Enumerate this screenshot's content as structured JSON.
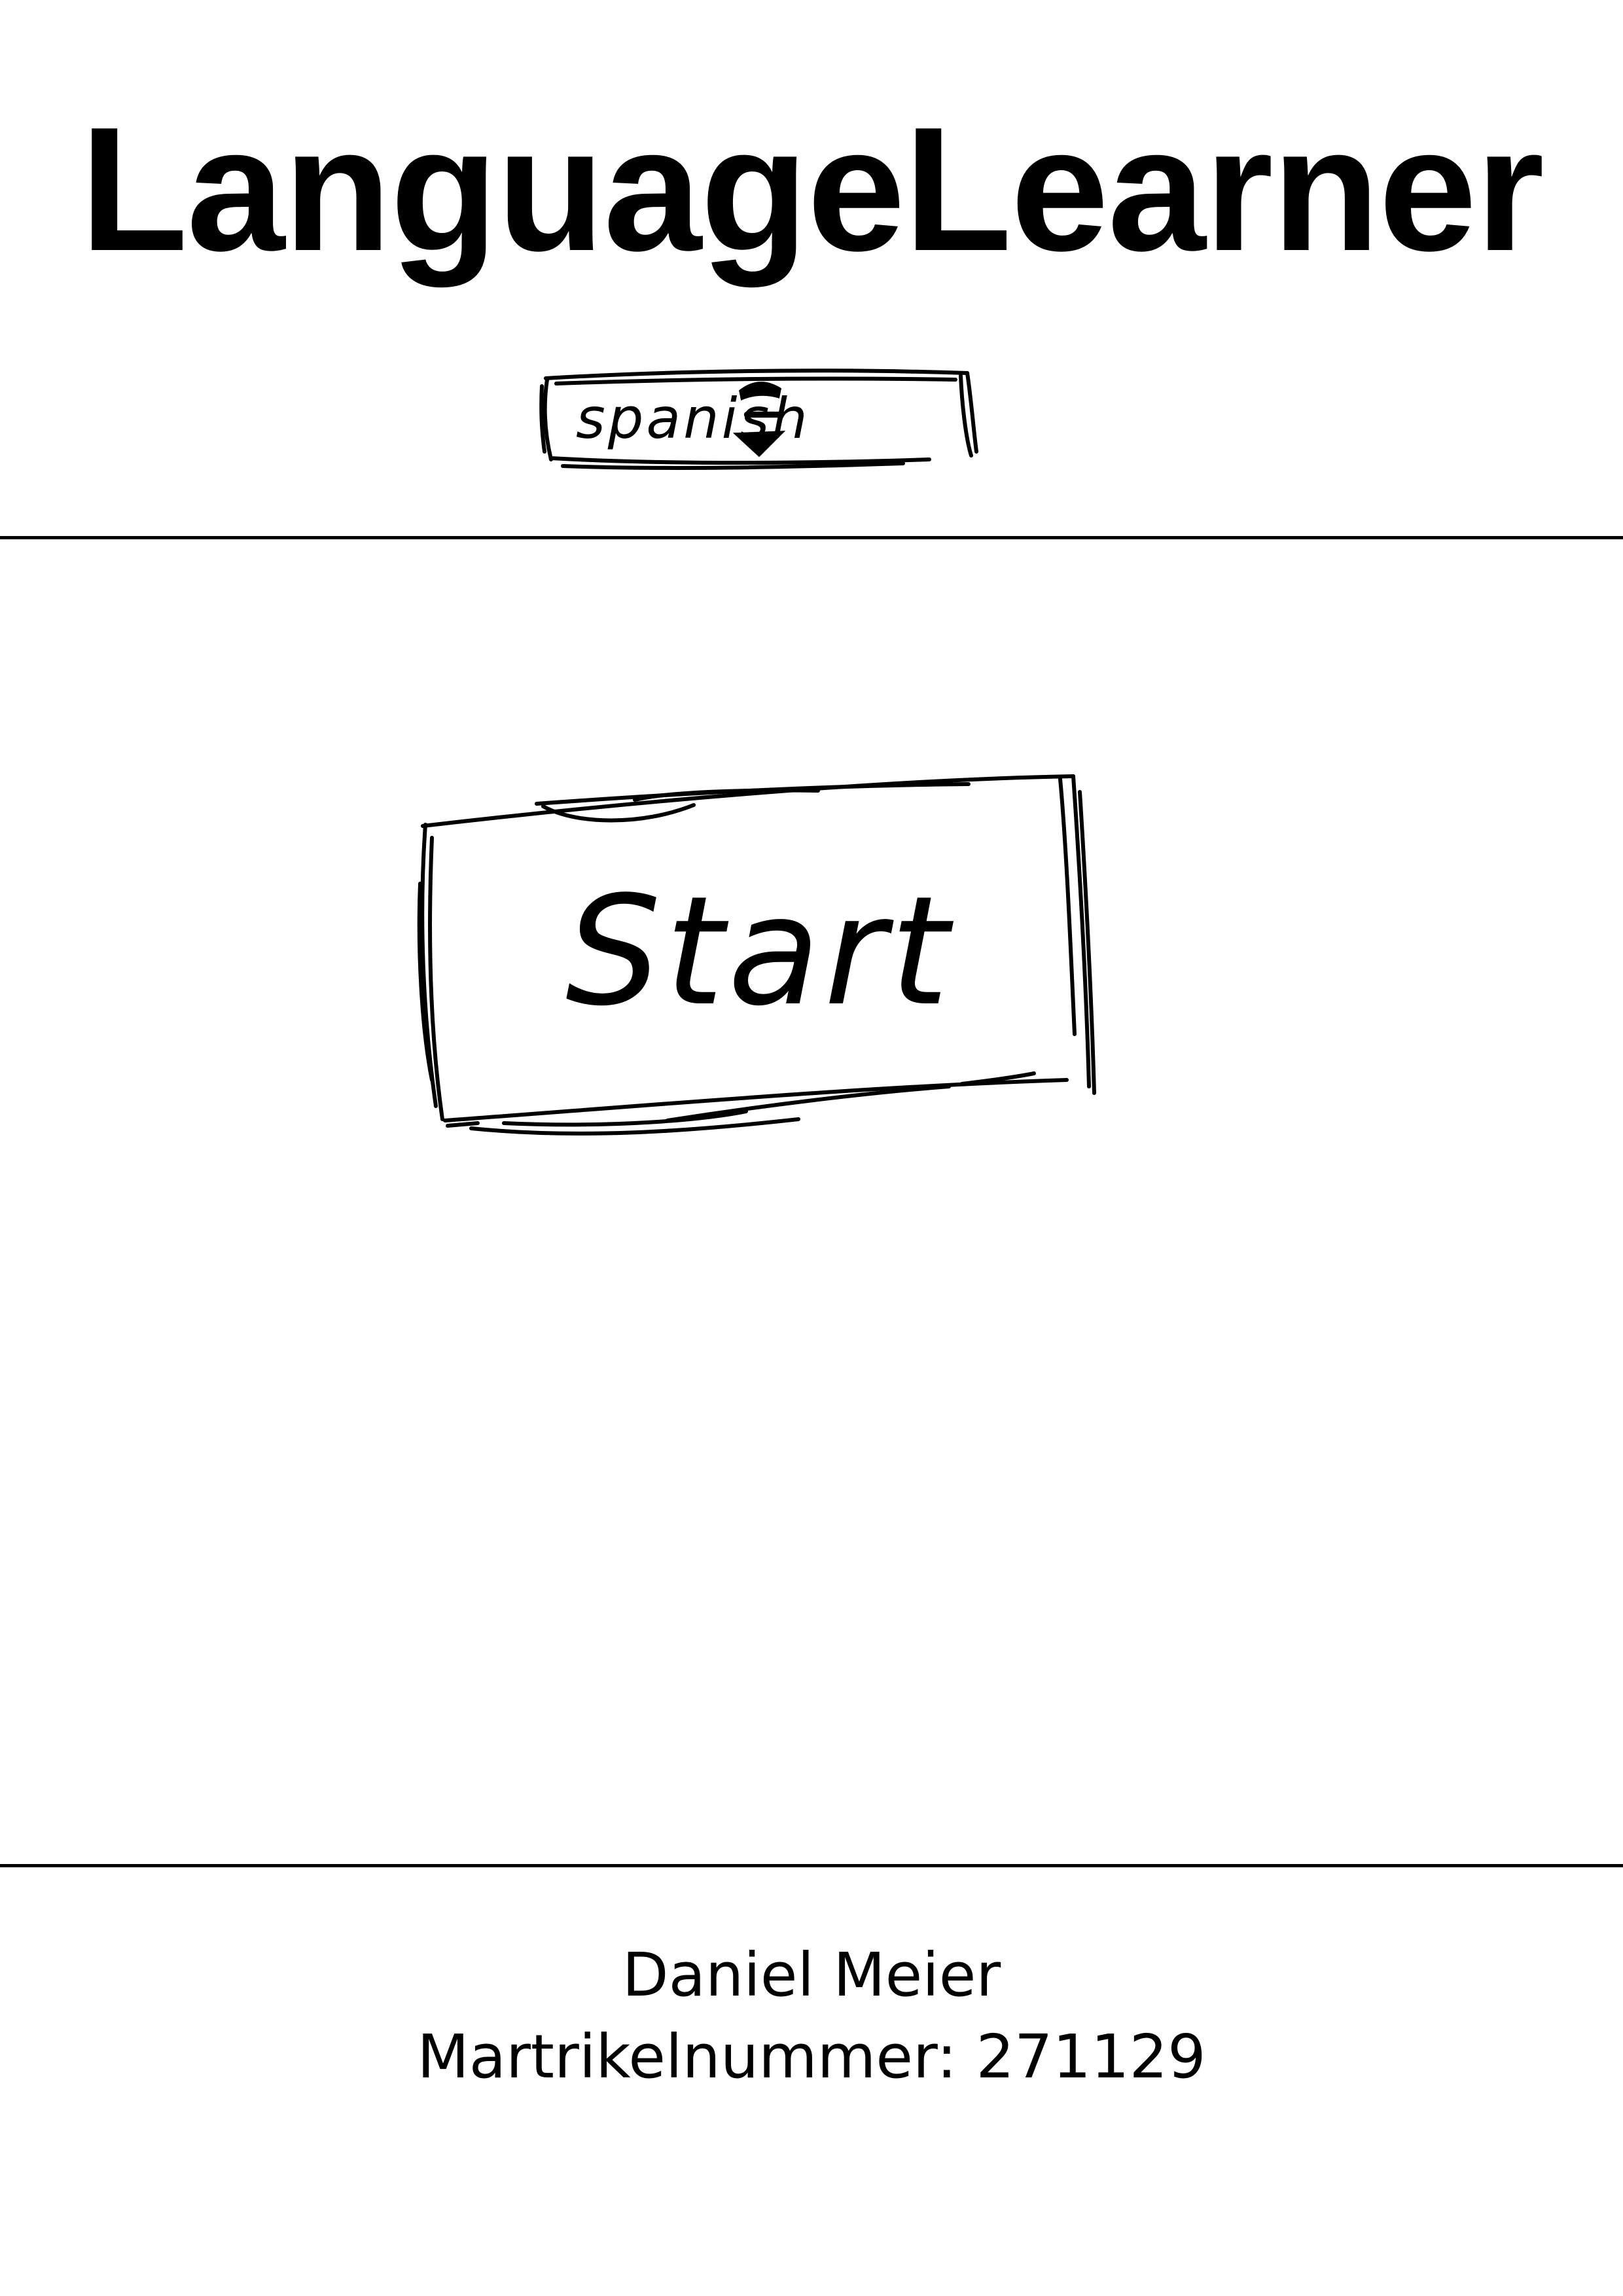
{
  "header": {
    "title": "LanguageLearner"
  },
  "language_selector": {
    "selected": "spanish",
    "icon": "stepper-arrows-icon"
  },
  "main": {
    "start_label": "Start"
  },
  "footer": {
    "author": "Daniel Meier",
    "student_id": "Martrikelnummer: 271129"
  },
  "colors": {
    "ink": "#000000",
    "background": "#ffffff"
  }
}
